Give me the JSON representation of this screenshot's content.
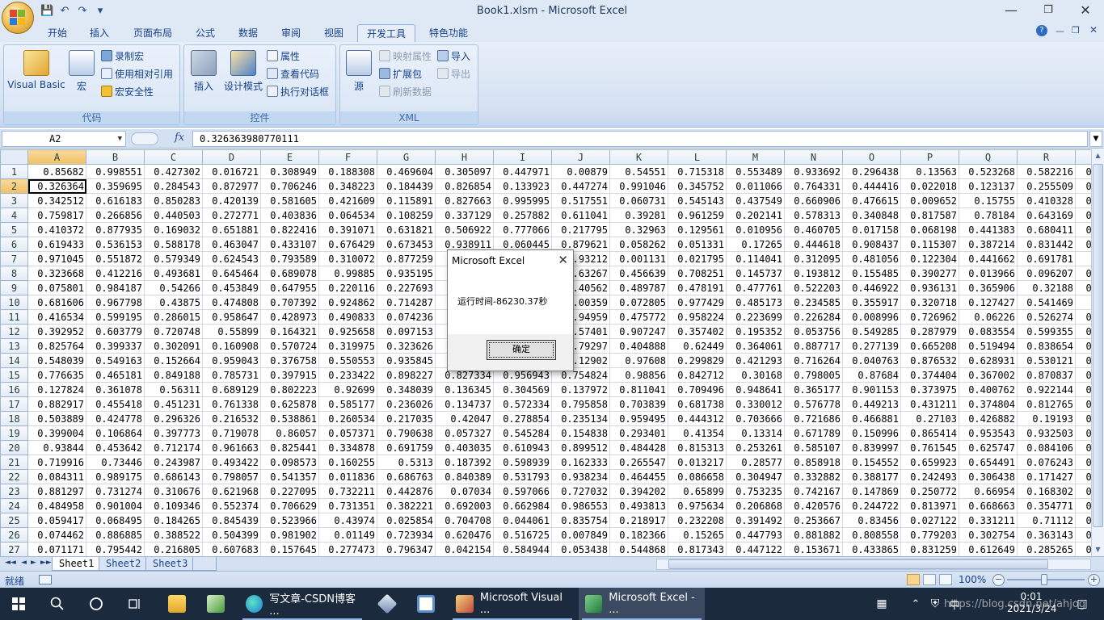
{
  "window": {
    "title": "Book1.xlsm - Microsoft Excel",
    "min_glyph": "—",
    "max_glyph": "❐",
    "close_glyph": "✕"
  },
  "qat": {
    "save": "💾",
    "undo": "↶",
    "redo": "↷",
    "more": "▾"
  },
  "tabs": [
    "开始",
    "插入",
    "页面布局",
    "公式",
    "数据",
    "审阅",
    "视图",
    "开发工具",
    "特色功能"
  ],
  "ribbon": {
    "code": {
      "label": "代码",
      "visual_basic": "Visual Basic",
      "macros": "宏",
      "record_macro": "录制宏",
      "relative_ref": "使用相对引用",
      "macro_security": "宏安全性"
    },
    "controls": {
      "label": "控件",
      "insert": "插入",
      "design_mode": "设计模式",
      "properties": "属性",
      "view_code": "查看代码",
      "run_dialog": "执行对话框"
    },
    "xml": {
      "label": "XML",
      "source": "源",
      "map_properties": "映射属性",
      "expansion_packs": "扩展包",
      "refresh_data": "刷新数据",
      "import": "导入",
      "export": "导出"
    }
  },
  "formula_bar": {
    "name_box": "A2",
    "fx": "fx",
    "value": "0.326363980770111"
  },
  "columns": [
    "A",
    "B",
    "C",
    "D",
    "E",
    "F",
    "G",
    "H",
    "I",
    "J",
    "K",
    "L",
    "M",
    "N",
    "O",
    "P",
    "Q",
    "R",
    ""
  ],
  "rows": [
    [
      "0.85682",
      "0.998551",
      "0.427302",
      "0.016721",
      "0.308949",
      "0.188308",
      "0.469604",
      "0.305097",
      "0.447971",
      "0.00879",
      "0.54551",
      "0.715318",
      "0.553489",
      "0.933692",
      "0.296438",
      "0.13563",
      "0.523268",
      "0.582216",
      "0."
    ],
    [
      "0.326364",
      "0.359695",
      "0.284543",
      "0.872977",
      "0.706246",
      "0.348223",
      "0.184439",
      "0.826854",
      "0.133923",
      "0.447274",
      "0.991046",
      "0.345752",
      "0.011066",
      "0.764331",
      "0.444416",
      "0.022018",
      "0.123137",
      "0.255509",
      "0."
    ],
    [
      "0.342512",
      "0.616183",
      "0.850283",
      "0.420139",
      "0.581605",
      "0.421609",
      "0.115891",
      "0.827663",
      "0.995995",
      "0.517551",
      "0.060731",
      "0.545143",
      "0.437549",
      "0.660906",
      "0.476615",
      "0.009652",
      "0.15755",
      "0.410328",
      "0."
    ],
    [
      "0.759817",
      "0.266856",
      "0.440503",
      "0.272771",
      "0.403836",
      "0.064534",
      "0.108259",
      "0.337129",
      "0.257882",
      "0.611041",
      "0.39281",
      "0.961259",
      "0.202141",
      "0.578313",
      "0.340848",
      "0.817587",
      "0.78184",
      "0.643169",
      "0."
    ],
    [
      "0.410372",
      "0.877935",
      "0.169032",
      "0.651881",
      "0.822416",
      "0.391071",
      "0.631821",
      "0.506922",
      "0.777066",
      "0.217795",
      "0.32963",
      "0.129561",
      "0.010956",
      "0.460705",
      "0.017158",
      "0.068198",
      "0.441383",
      "0.680411",
      "0."
    ],
    [
      "0.619433",
      "0.536153",
      "0.588178",
      "0.463047",
      "0.433107",
      "0.676429",
      "0.673453",
      "0.938911",
      "0.060445",
      "0.879621",
      "0.058262",
      "0.051331",
      "0.17265",
      "0.444618",
      "0.908437",
      "0.115307",
      "0.387214",
      "0.831442",
      "0."
    ],
    [
      "0.971045",
      "0.551872",
      "0.579349",
      "0.624543",
      "0.793589",
      "0.310072",
      "0.877259",
      "",
      "",
      "0.93212",
      "0.001131",
      "0.021795",
      "0.114041",
      "0.312095",
      "0.481056",
      "0.122304",
      "0.441662",
      "0.691781",
      "0"
    ],
    [
      "0.323668",
      "0.412216",
      "0.493681",
      "0.645464",
      "0.689078",
      "0.99885",
      "0.935195",
      "",
      "",
      "0.63267",
      "0.456639",
      "0.708251",
      "0.145737",
      "0.193812",
      "0.155485",
      "0.390277",
      "0.013966",
      "0.096207",
      "0."
    ],
    [
      "0.075801",
      "0.984187",
      "0.54266",
      "0.453849",
      "0.647955",
      "0.220116",
      "0.227693",
      "",
      "",
      "0.40562",
      "0.489787",
      "0.478191",
      "0.477761",
      "0.522203",
      "0.446922",
      "0.936131",
      "0.365906",
      "0.32188",
      "0."
    ],
    [
      "0.681606",
      "0.967798",
      "0.43875",
      "0.474808",
      "0.707392",
      "0.924862",
      "0.714287",
      "",
      "",
      "0.00359",
      "0.072805",
      "0.977429",
      "0.485173",
      "0.234585",
      "0.355917",
      "0.320718",
      "0.127427",
      "0.541469",
      "0"
    ],
    [
      "0.416534",
      "0.599195",
      "0.286015",
      "0.958647",
      "0.428973",
      "0.490833",
      "0.074236",
      "",
      "",
      "0.94959",
      "0.475772",
      "0.958224",
      "0.223699",
      "0.226284",
      "0.008996",
      "0.726962",
      "0.06226",
      "0.526274",
      "0."
    ],
    [
      "0.392952",
      "0.603779",
      "0.720748",
      "0.55899",
      "0.164321",
      "0.925658",
      "0.097153",
      "",
      "",
      "0.57401",
      "0.907247",
      "0.357402",
      "0.195352",
      "0.053756",
      "0.549285",
      "0.287979",
      "0.083554",
      "0.599355",
      "0."
    ],
    [
      "0.825764",
      "0.399337",
      "0.302091",
      "0.160908",
      "0.570724",
      "0.319975",
      "0.323626",
      "",
      "",
      "0.79297",
      "0.404888",
      "0.62449",
      "0.364061",
      "0.887717",
      "0.277139",
      "0.665208",
      "0.519494",
      "0.838654",
      "0."
    ],
    [
      "0.548039",
      "0.549163",
      "0.152664",
      "0.959043",
      "0.376758",
      "0.550553",
      "0.935845",
      "",
      "",
      "0.12902",
      "0.97608",
      "0.299829",
      "0.421293",
      "0.716264",
      "0.040763",
      "0.876532",
      "0.628931",
      "0.530121",
      "0."
    ],
    [
      "0.776635",
      "0.465181",
      "0.849188",
      "0.785731",
      "0.397915",
      "0.233422",
      "0.898227",
      "0.827334",
      "0.956943",
      "0.754824",
      "0.98856",
      "0.842712",
      "0.30168",
      "0.798005",
      "0.87684",
      "0.374404",
      "0.367002",
      "0.870837",
      "0."
    ],
    [
      "0.127824",
      "0.361078",
      "0.56311",
      "0.689129",
      "0.802223",
      "0.92699",
      "0.348039",
      "0.136345",
      "0.304569",
      "0.137972",
      "0.811041",
      "0.709496",
      "0.948641",
      "0.365177",
      "0.901153",
      "0.373975",
      "0.400762",
      "0.922144",
      "0."
    ],
    [
      "0.882917",
      "0.455418",
      "0.451231",
      "0.761338",
      "0.625878",
      "0.585177",
      "0.236026",
      "0.134737",
      "0.572334",
      "0.795858",
      "0.703839",
      "0.681738",
      "0.330012",
      "0.576778",
      "0.449213",
      "0.431211",
      "0.374804",
      "0.812765",
      "0."
    ],
    [
      "0.503889",
      "0.424778",
      "0.296326",
      "0.216532",
      "0.538861",
      "0.260534",
      "0.217035",
      "0.42047",
      "0.278854",
      "0.235134",
      "0.959495",
      "0.444312",
      "0.703666",
      "0.721686",
      "0.466881",
      "0.27103",
      "0.426882",
      "0.19193",
      "0."
    ],
    [
      "0.399004",
      "0.106864",
      "0.397773",
      "0.719078",
      "0.86057",
      "0.057371",
      "0.790638",
      "0.057327",
      "0.545284",
      "0.154838",
      "0.293401",
      "0.41354",
      "0.13314",
      "0.671789",
      "0.150996",
      "0.865414",
      "0.953543",
      "0.932503",
      "0."
    ],
    [
      "0.93844",
      "0.453642",
      "0.712174",
      "0.961663",
      "0.825441",
      "0.334878",
      "0.691759",
      "0.403035",
      "0.610943",
      "0.899512",
      "0.484428",
      "0.815313",
      "0.253261",
      "0.585107",
      "0.839997",
      "0.761545",
      "0.625747",
      "0.084106",
      "0."
    ],
    [
      "0.719916",
      "0.73446",
      "0.243987",
      "0.493422",
      "0.098573",
      "0.160255",
      "0.5313",
      "0.187392",
      "0.598939",
      "0.162333",
      "0.265547",
      "0.013217",
      "0.28577",
      "0.858918",
      "0.154552",
      "0.659923",
      "0.654491",
      "0.076243",
      "0."
    ],
    [
      "0.084311",
      "0.989175",
      "0.686143",
      "0.798057",
      "0.541357",
      "0.011836",
      "0.686763",
      "0.840389",
      "0.531793",
      "0.938234",
      "0.464455",
      "0.086658",
      "0.304947",
      "0.332882",
      "0.388177",
      "0.242493",
      "0.306438",
      "0.171427",
      "0."
    ],
    [
      "0.881297",
      "0.731274",
      "0.310676",
      "0.621968",
      "0.227095",
      "0.732211",
      "0.442876",
      "0.07034",
      "0.597066",
      "0.727032",
      "0.394202",
      "0.65899",
      "0.753235",
      "0.742167",
      "0.147869",
      "0.250772",
      "0.66954",
      "0.168302",
      "0."
    ],
    [
      "0.484958",
      "0.901004",
      "0.109346",
      "0.552374",
      "0.706629",
      "0.731351",
      "0.382221",
      "0.692003",
      "0.662984",
      "0.986553",
      "0.493813",
      "0.975634",
      "0.206868",
      "0.420576",
      "0.244722",
      "0.813971",
      "0.668663",
      "0.354771",
      "0."
    ],
    [
      "0.059417",
      "0.068495",
      "0.184265",
      "0.845439",
      "0.523966",
      "0.43974",
      "0.025854",
      "0.704708",
      "0.044061",
      "0.835754",
      "0.218917",
      "0.232208",
      "0.391492",
      "0.253667",
      "0.83456",
      "0.027122",
      "0.331211",
      "0.71112",
      "0."
    ],
    [
      "0.074462",
      "0.886885",
      "0.388522",
      "0.504399",
      "0.981902",
      "0.01149",
      "0.723934",
      "0.620476",
      "0.516725",
      "0.007849",
      "0.182366",
      "0.15265",
      "0.447793",
      "0.881882",
      "0.808558",
      "0.779203",
      "0.302754",
      "0.363143",
      "0."
    ],
    [
      "0.071171",
      "0.795442",
      "0.216805",
      "0.607683",
      "0.157645",
      "0.277473",
      "0.796347",
      "0.042154",
      "0.584944",
      "0.053438",
      "0.544868",
      "0.817343",
      "0.447122",
      "0.153671",
      "0.433865",
      "0.831259",
      "0.612649",
      "0.285265",
      "0."
    ]
  ],
  "sheets": [
    "Sheet1",
    "Sheet2",
    "Sheet3"
  ],
  "status": {
    "ready": "就绪",
    "zoom": "100%"
  },
  "dialog": {
    "title": "Microsoft Excel",
    "message": "运行时间-86230.37秒",
    "ok": "确定"
  },
  "taskbar": {
    "apps": [
      {
        "label": "写文章-CSDN博客 ..."
      },
      {
        "label": "Microsoft Visual ..."
      },
      {
        "label": "Microsoft Excel - ..."
      }
    ],
    "time": "0:01",
    "date": "2021/3/24",
    "ime": "中",
    "watermark": "https://blog.csdn.net/ahjog"
  }
}
